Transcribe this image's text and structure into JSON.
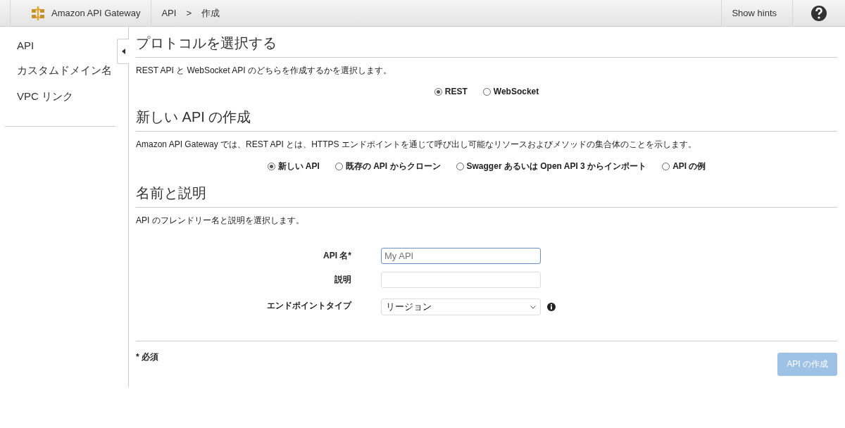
{
  "header": {
    "brand": "Amazon API Gateway",
    "breadcrumbs": [
      "API",
      "作成"
    ],
    "separator": ">",
    "hints_button": "Show hints"
  },
  "sidebar": {
    "items": [
      {
        "label": "API"
      },
      {
        "label": "カスタムドメイン名"
      },
      {
        "label": "VPC リンク"
      }
    ]
  },
  "sections": [
    {
      "title": "プロトコルを選択する",
      "description": "REST API と WebSocket API のどちらを作成するかを選択します。",
      "options": [
        {
          "label": "REST",
          "selected": true
        },
        {
          "label": "WebSocket",
          "selected": false
        }
      ]
    },
    {
      "title": "新しい API の作成",
      "description": "Amazon API Gateway では、REST API とは、HTTPS エンドポイントを通じて呼び出し可能なリソースおよびメソッドの集合体のことを示します。",
      "options": [
        {
          "label": "新しい API",
          "selected": true
        },
        {
          "label": "既存の API からクローン",
          "selected": false
        },
        {
          "label": "Swagger あるいは Open API 3 からインポート",
          "selected": false
        },
        {
          "label": "API の例",
          "selected": false
        }
      ]
    },
    {
      "title": "名前と説明",
      "description": "API のフレンドリー名と説明を選択します。"
    }
  ],
  "form": {
    "fields": [
      {
        "kind": "text",
        "label": "API 名*",
        "placeholder": "My API",
        "focused": true
      },
      {
        "kind": "text",
        "label": "説明",
        "focused": false
      },
      {
        "kind": "select",
        "label": "エンドポイントタイプ",
        "value": "リージョン",
        "focused": false
      }
    ]
  },
  "footer": {
    "required_note": "* 必須",
    "create_button": {
      "label": "API の作成",
      "disabled": true
    }
  }
}
